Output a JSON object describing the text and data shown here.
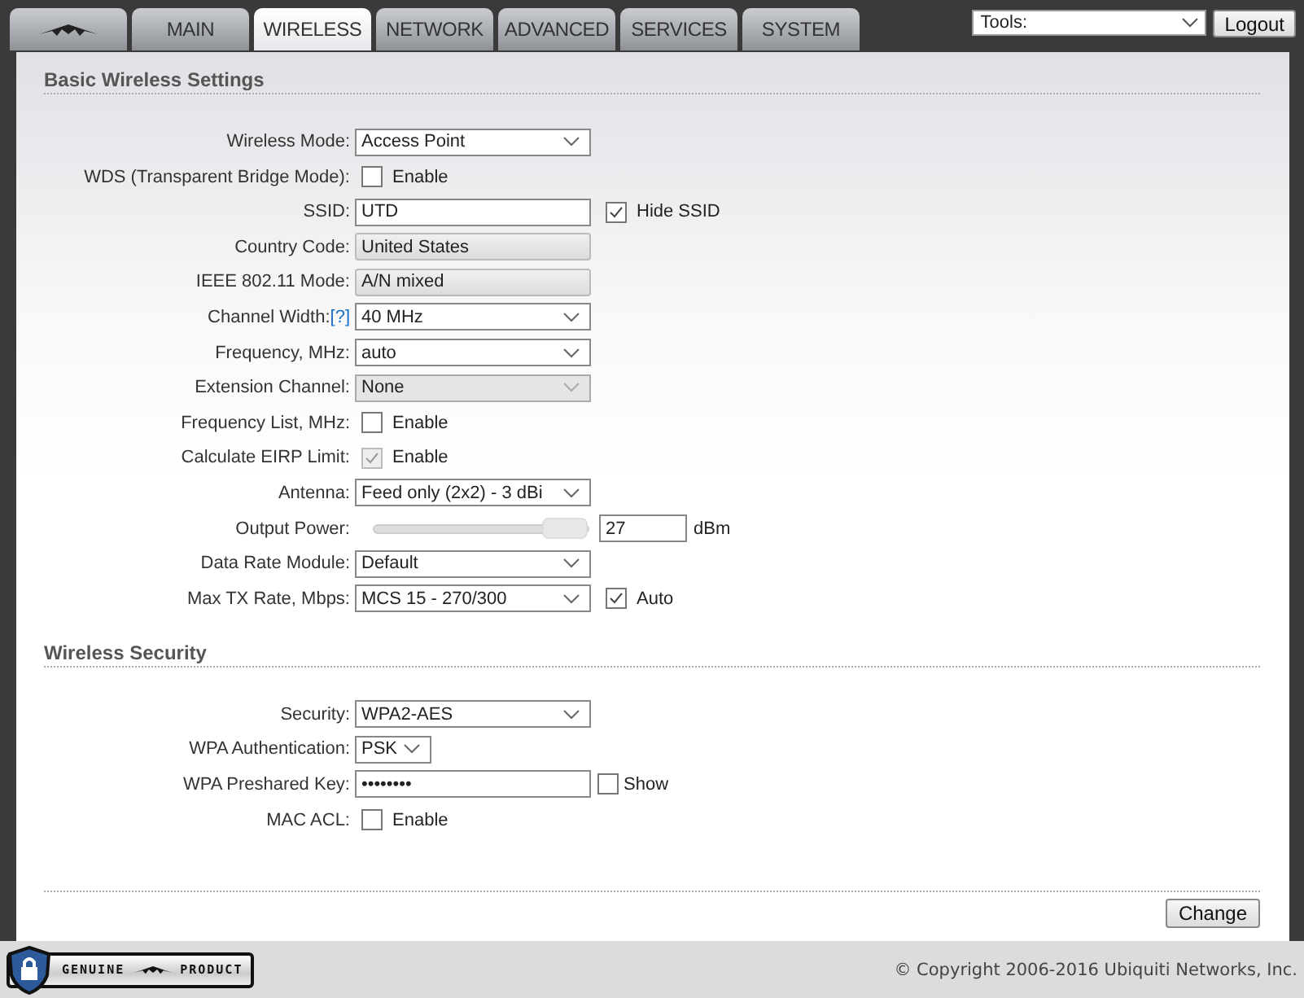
{
  "tabs": [
    {
      "kind": "logo",
      "selected": false
    },
    {
      "kind": "text",
      "label": "MAIN",
      "selected": false
    },
    {
      "kind": "text",
      "label": "WIRELESS",
      "selected": true
    },
    {
      "kind": "text",
      "label": "NETWORK",
      "selected": false
    },
    {
      "kind": "text",
      "label": "ADVANCED",
      "selected": false
    },
    {
      "kind": "text",
      "label": "SERVICES",
      "selected": false
    },
    {
      "kind": "text",
      "label": "SYSTEM",
      "selected": false
    }
  ],
  "tools": {
    "value": "Tools:"
  },
  "logout": "Logout",
  "sections": [
    {
      "title": "Basic Wireless Settings",
      "rows": [
        {
          "label": "Wireless Mode:",
          "kind": "select",
          "value": "Access Point"
        },
        {
          "label": "WDS (Transparent Bridge Mode):",
          "kind": "checkbox",
          "checked": false,
          "option": "Enable"
        },
        {
          "label": "SSID:",
          "kind": "text",
          "value": "UTD",
          "extra": {
            "label": "Hide SSID",
            "checked": true
          }
        },
        {
          "label": "Country Code:",
          "kind": "readonly",
          "value": "United States"
        },
        {
          "label": "IEEE 802.11 Mode:",
          "kind": "readonly",
          "value": "A/N mixed"
        },
        {
          "label": "Channel Width:",
          "help": "[?]",
          "kind": "select",
          "value": "40 MHz"
        },
        {
          "label": "Frequency, MHz:",
          "kind": "select",
          "value": "auto"
        },
        {
          "label": "Extension Channel:",
          "kind": "select",
          "value": "None",
          "disabled": true
        },
        {
          "label": "Frequency List, MHz:",
          "kind": "checkbox",
          "checked": false,
          "option": "Enable"
        },
        {
          "label": "Calculate EIRP Limit:",
          "kind": "checkbox",
          "checked": true,
          "disabled": true,
          "option": "Enable"
        },
        {
          "label": "Antenna:",
          "kind": "select",
          "value": "Feed only (2x2) - 3 dBi"
        },
        {
          "label": "Output Power:",
          "kind": "slider",
          "level": 1,
          "value": "27",
          "unit": "dBm"
        },
        {
          "label": "Data Rate Module:",
          "kind": "select",
          "value": "Default"
        },
        {
          "label": "Max TX Rate, Mbps:",
          "kind": "select",
          "value": "MCS 15 - 270/300",
          "extra": {
            "label": "Auto",
            "checked": true
          }
        }
      ]
    },
    {
      "title": "Wireless Security",
      "rows": [
        {
          "label": "Security:",
          "kind": "select",
          "value": "WPA2-AES"
        },
        {
          "label": "WPA Authentication:",
          "kind": "short-select",
          "value": "PSK"
        },
        {
          "label": "WPA Preshared Key:",
          "kind": "password",
          "value": "••••••••",
          "extra": {
            "label": "Show",
            "checked": false
          }
        },
        {
          "label": "MAC ACL:",
          "kind": "checkbox",
          "checked": false,
          "option": "Enable"
        }
      ]
    }
  ],
  "change": "Change",
  "badge": {
    "left": "GENUINE",
    "right": "PRODUCT"
  },
  "copyright": "© Copyright 2006-2016 Ubiquiti Networks, Inc."
}
